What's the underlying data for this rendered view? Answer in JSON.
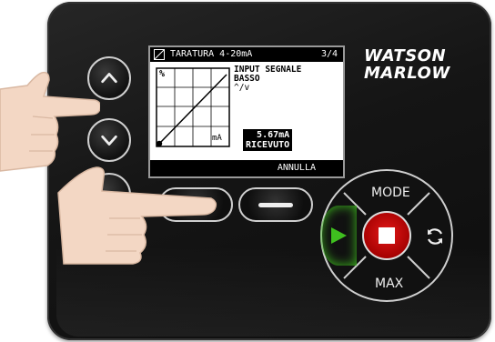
{
  "screen": {
    "title": "TARATURA 4-20mA",
    "page": "3/4",
    "graph_y_label": "%",
    "graph_x_label": "mA",
    "info_line1": "INPUT SEGNALE",
    "info_line2": "BASSO",
    "info_line3": "^/v",
    "reading_value": "5.67mA",
    "reading_label": "RICEVUTO",
    "softkey_right_label": "ANNULLA"
  },
  "brand": {
    "line1": "WATSON",
    "line2": "MARLOW"
  },
  "dpad": {
    "top": "MODE",
    "bottom": "MAX"
  },
  "icons": {
    "up": "chevron-up-icon",
    "down": "chevron-down-icon",
    "play": "play-icon",
    "stop": "stop-icon",
    "cycle": "cycle-icon",
    "graph": "calibration-graph-icon"
  },
  "colors": {
    "play": "#3fbf1f",
    "stop": "#d40000",
    "panel": "#151515"
  }
}
